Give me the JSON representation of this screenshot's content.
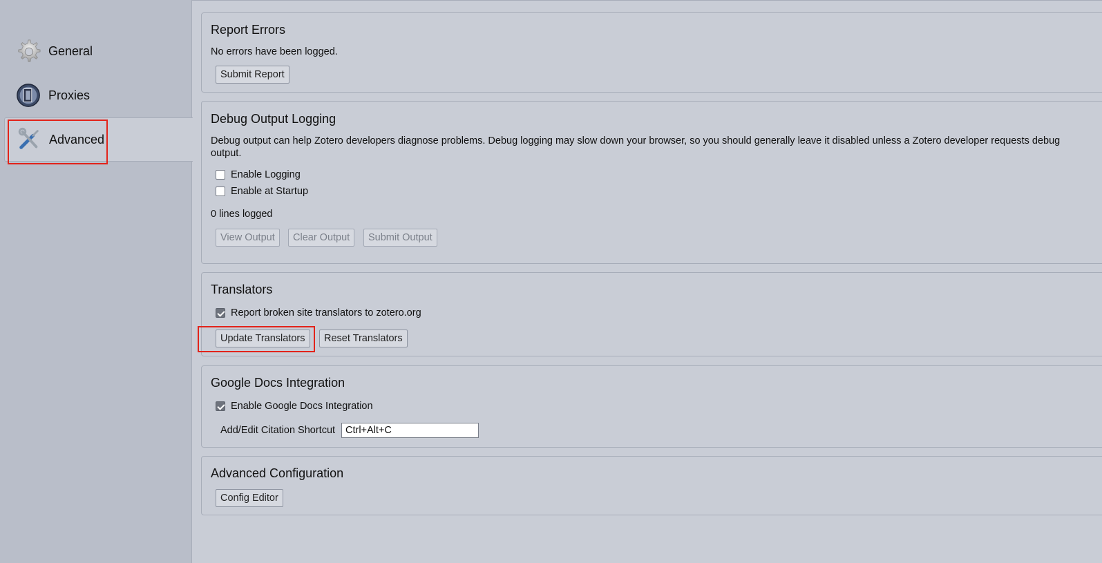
{
  "sidebar": {
    "items": [
      {
        "label": "General",
        "icon": "gear-icon"
      },
      {
        "label": "Proxies",
        "icon": "proxies-icon"
      },
      {
        "label": "Advanced",
        "icon": "tools-icon"
      }
    ],
    "active": "Advanced"
  },
  "report_errors": {
    "title": "Report Errors",
    "status": "No errors have been logged.",
    "submit_label": "Submit Report"
  },
  "debug": {
    "title": "Debug Output Logging",
    "description": "Debug output can help Zotero developers diagnose problems. Debug logging may slow down your browser, so you should generally leave it disabled unless a Zotero developer requests debug output.",
    "enable_logging_label": "Enable Logging",
    "enable_logging_checked": false,
    "enable_startup_label": "Enable at Startup",
    "enable_startup_checked": false,
    "lines_logged": "0 lines logged",
    "view_label": "View Output",
    "clear_label": "Clear Output",
    "submit_label": "Submit Output"
  },
  "translators": {
    "title": "Translators",
    "report_broken_label": "Report broken site translators to zotero.org",
    "report_broken_checked": true,
    "update_label": "Update Translators",
    "reset_label": "Reset Translators"
  },
  "gdocs": {
    "title": "Google Docs Integration",
    "enable_label": "Enable Google Docs Integration",
    "enable_checked": true,
    "shortcut_label": "Add/Edit Citation Shortcut",
    "shortcut_value": "Ctrl+Alt+C"
  },
  "advanced_config": {
    "title": "Advanced Configuration",
    "editor_label": "Config Editor"
  },
  "colors": {
    "highlight": "#e2231a",
    "background": "#c9cdd6",
    "sidebar": "#b9bec9"
  }
}
